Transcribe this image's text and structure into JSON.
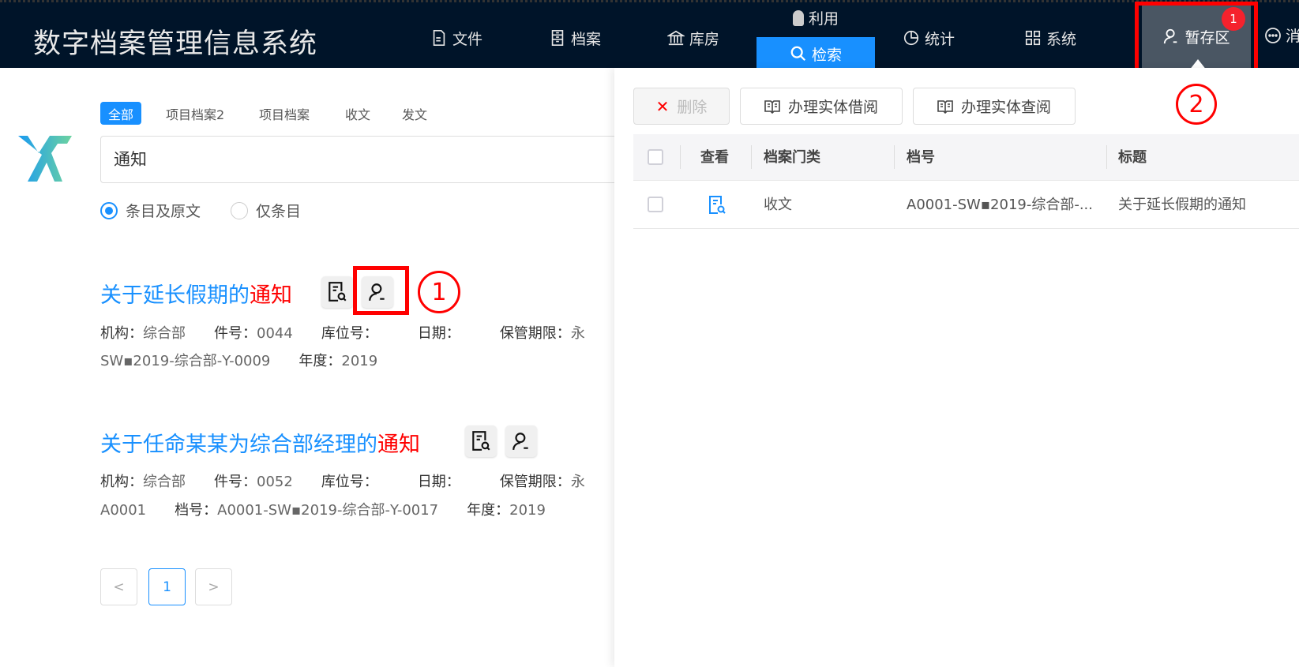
{
  "header": {
    "app_title": "数字档案管理信息系统",
    "nav": [
      {
        "label": "文件",
        "icon": "file-icon"
      },
      {
        "label": "档案",
        "icon": "archive-icon"
      },
      {
        "label": "库房",
        "icon": "bank-icon"
      },
      {
        "label": "利用",
        "icon": "bulb-icon"
      },
      {
        "label": "检索",
        "icon": "search-icon",
        "active": true
      },
      {
        "label": "统计",
        "icon": "pie-chart-icon"
      },
      {
        "label": "系统",
        "icon": "grid-icon"
      },
      {
        "label": "暂存区",
        "icon": "user-icon",
        "badge": "1"
      },
      {
        "label": "消",
        "icon": "message-icon"
      }
    ],
    "accent": "#1890ff"
  },
  "search": {
    "tabs": [
      "全部",
      "项目档案2",
      "项目档案",
      "收文",
      "发文"
    ],
    "query": "通知",
    "scope_options": [
      "条目及原文",
      "仅条目"
    ],
    "scope_selected": "条目及原文"
  },
  "results": [
    {
      "title_prefix": "关于延长假期的",
      "title_highlight": "通知",
      "line1": [
        [
          "机构：",
          "综合部"
        ],
        [
          "件号：",
          "0044"
        ],
        [
          "库位号：",
          ""
        ],
        [
          "日期：",
          ""
        ],
        [
          "保管期限：",
          "永"
        ]
      ],
      "line2": [
        [
          "",
          "SW▪2019-综合部-Y-0009"
        ],
        [
          "年度：",
          "2019"
        ]
      ]
    },
    {
      "title_prefix": "关于任命某某为综合部经理的",
      "title_highlight": "通知",
      "line1": [
        [
          "机构：",
          "综合部"
        ],
        [
          "件号：",
          "0052"
        ],
        [
          "库位号：",
          ""
        ],
        [
          "日期：",
          ""
        ],
        [
          "保管期限：",
          "永"
        ]
      ],
      "line2": [
        [
          "",
          "A0001"
        ],
        [
          "档号：",
          "A0001-SW▪2019-综合部-Y-0017"
        ],
        [
          "年度：",
          "2019"
        ]
      ]
    }
  ],
  "pagination": {
    "prev": "<",
    "current": "1",
    "next": ">"
  },
  "annotations": {
    "step1": "1",
    "step2": "2"
  },
  "stash_panel": {
    "buttons": {
      "delete": "删除",
      "borrow": "办理实体借阅",
      "consult": "办理实体查阅"
    },
    "columns": [
      "查看",
      "档案门类",
      "档号",
      "标题"
    ],
    "rows": [
      {
        "category": "收文",
        "archive_no": "A0001-SW▪2019-综合部-...",
        "title": "关于延长假期的通知"
      }
    ]
  }
}
